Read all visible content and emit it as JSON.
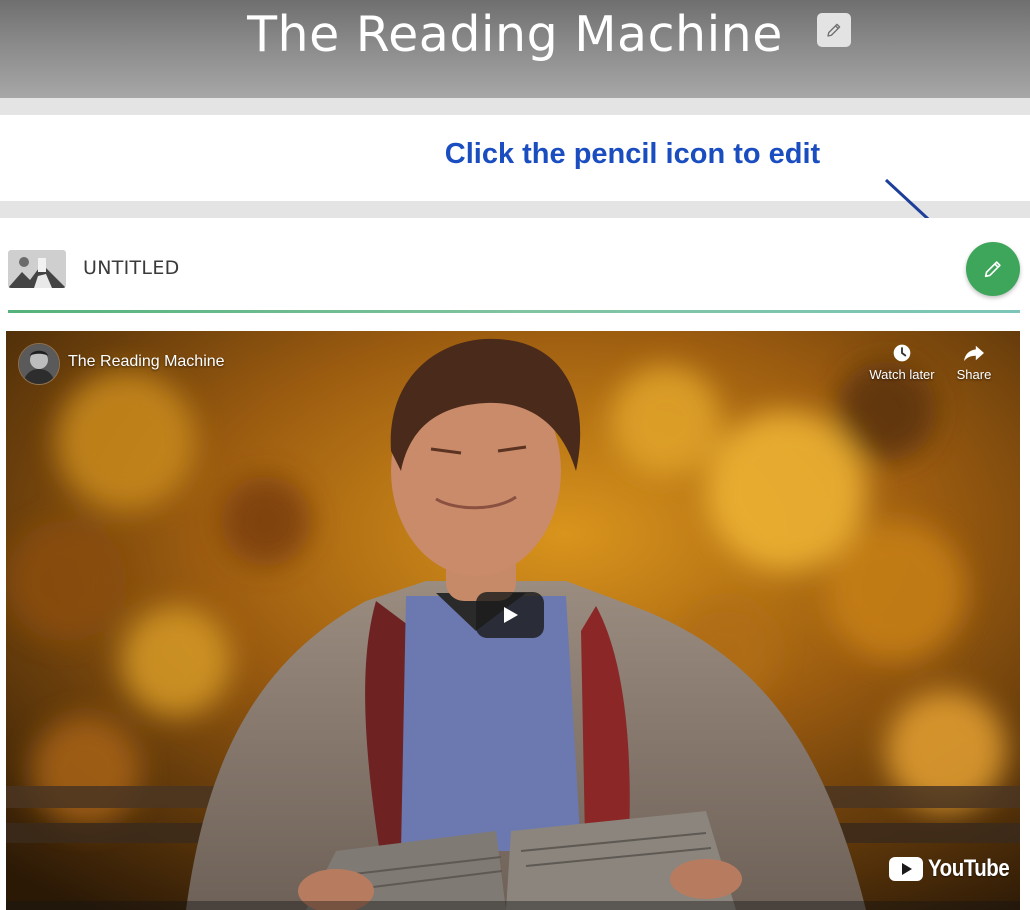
{
  "header": {
    "title": "The Reading Machine"
  },
  "instruction": {
    "text": "Click the pencil icon to edit"
  },
  "section": {
    "title": "UNTITLED"
  },
  "video": {
    "title": "The Reading Machine",
    "watch_later_label": "Watch later",
    "share_label": "Share",
    "brand_label": "YouTube"
  },
  "colors": {
    "accent_green": "#3ea65a",
    "instruction_blue": "#1a4dbf",
    "header_gray": "#8a8a8a"
  },
  "icons": {
    "title_edit": "pencil-icon",
    "fab": "pencil-icon",
    "watch_later": "clock-icon",
    "share": "share-arrow-icon",
    "play": "play-icon",
    "brand": "youtube-logo-icon"
  }
}
